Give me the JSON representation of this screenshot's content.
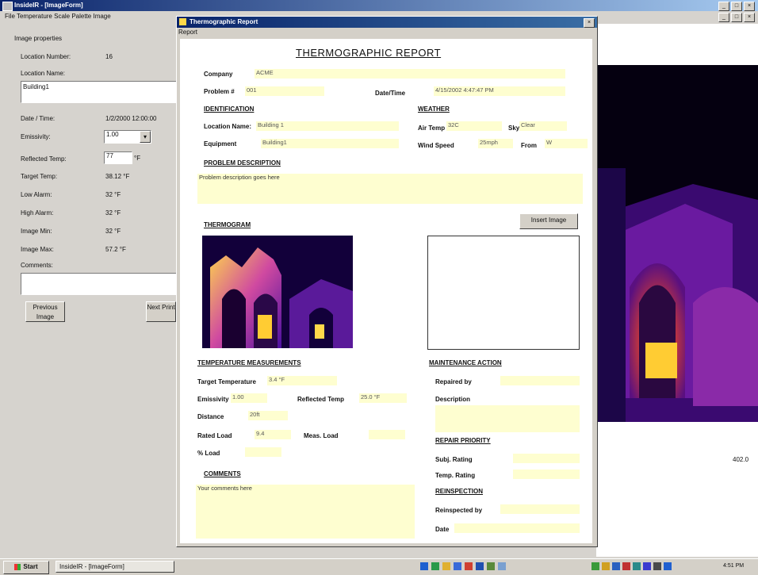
{
  "window": {
    "title": "InsideIR - [ImageForm]",
    "menu": "File  Temperature Scale  Palette  Image"
  },
  "left_panel": {
    "header": "Image properties",
    "location_number_label": "Location Number:",
    "location_number": "16",
    "location_name_label": "Location Name:",
    "location_name": "Building1",
    "date_label": "Date / Time:",
    "date_value": "1/2/2000 12:00:00",
    "emissivity_label": "Emissivity:",
    "emissivity_value": "1.00",
    "reflected_label": "Reflected Temp:",
    "reflected_value": "77",
    "reflected_unit": "°F",
    "target_label": "Target Temp:",
    "target_value": "38.12 °F",
    "low_label": "Low Alarm:",
    "low_value": "32 °F",
    "high_label": "High Alarm:",
    "high_value": "32 °F",
    "min_label": "Image Min:",
    "min_value": "32 °F",
    "max_label": "Image Max:",
    "max_value": "57.2 °F",
    "comments_label": "Comments:",
    "prev_button": "Previous Image",
    "next_button": "Next Print"
  },
  "viewer": {
    "readout": "402.0"
  },
  "dialog": {
    "title": "Thermographic Report",
    "menu": "Report",
    "heading": "THERMOGRAPHIC REPORT",
    "company_label": "Company",
    "company": "ACME",
    "problem_label": "Problem #",
    "problem": "001",
    "datetime_label": "Date/Time",
    "datetime": "4/15/2002 4:47:47 PM",
    "identification": "IDENTIFICATION",
    "location_label": "Location Name:",
    "location": "Building 1",
    "equipment_label": "Equipment",
    "equipment": "Building1",
    "weather": "WEATHER",
    "air_label": "Air Temp",
    "air": "32C",
    "sky_label": "Sky",
    "sky": "Clear",
    "wind_label": "Wind Speed",
    "wind": "25mph",
    "from_label": "From",
    "from": "W",
    "problem_desc": "PROBLEM DESCRIPTION",
    "problem_desc_text": "Problem description goes here",
    "thermogram": "THERMOGRAM",
    "insert_image": "Insert Image",
    "temp_meas": "TEMPERATURE MEASUREMENTS",
    "target_temp_label": "Target Temperature",
    "target_temp": "3.4 °F",
    "emissivity_label": "Emissivity",
    "emissivity": "1.00",
    "refl_label": "Reflected Temp",
    "refl": "25.0 °F",
    "distance_label": "Distance",
    "distance": "20ft",
    "rated_label": "Rated Load",
    "rated": "9.4",
    "meas_label": "Meas. Load",
    "load_label": "% Load",
    "comments": "COMMENTS",
    "comments_text": "Your comments here",
    "maint": "MAINTENANCE ACTION",
    "repaired_label": "Repaired by",
    "desc_label": "Description",
    "repair_priority": "REPAIR PRIORITY",
    "subj_label": "Subj. Rating",
    "temp_rating_label": "Temp. Rating",
    "reinspection": "REINSPECTION",
    "reinspected_label": "Reinspected by",
    "date_label": "Date"
  },
  "taskbar": {
    "start": "Start",
    "task": "InsideIR - [ImageForm]",
    "clock": "4:51 PM"
  },
  "colors": {
    "title_blue": "#0a246a",
    "field_yellow": "#fefed0",
    "thermal_dark": "#1a0040",
    "thermal_hot": "#ffd84a"
  }
}
